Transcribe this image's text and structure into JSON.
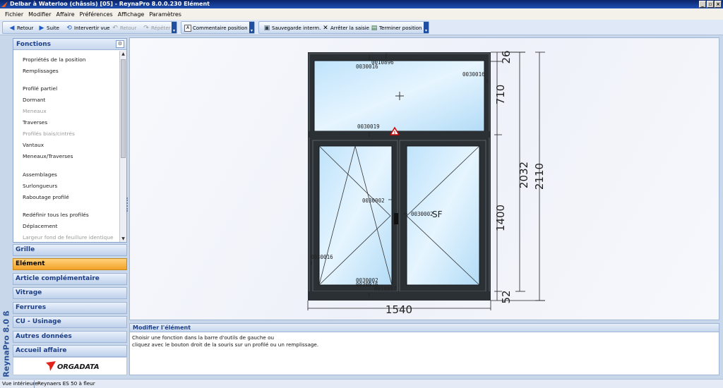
{
  "window": {
    "title": "Delbar à Waterloo (châssis) [05] - ReynaPro 8.0.0.230 Elément",
    "controls": [
      "_",
      "▫",
      "×"
    ]
  },
  "menu": [
    "Fichier",
    "Modifier",
    "Affaire",
    "Préférences",
    "Affichage",
    "Paramètres"
  ],
  "toolbar": {
    "retour": "Retour",
    "suite": "Suite",
    "intervertir": "Intervertir vue",
    "retour_disabled": "Retour",
    "repeter": "Répéter",
    "commentaire": "Commentaire position",
    "sauvegarde": "Sauvegarde interm.",
    "arreter": "Arrêter la saisie",
    "terminer": "Terminer position"
  },
  "brand_vertical": "ReynaPro 8.0 ß",
  "functions": {
    "title": "Fonctions",
    "items": [
      {
        "label": "Propriétés de la position",
        "disabled": false
      },
      {
        "label": "Remplissages",
        "disabled": false
      },
      {
        "label": "",
        "disabled": false
      },
      {
        "label": "Profilé partiel",
        "disabled": false
      },
      {
        "label": "Dormant",
        "disabled": false
      },
      {
        "label": "Meneaux",
        "disabled": true
      },
      {
        "label": "Traverses",
        "disabled": false
      },
      {
        "label": "Profilés biais/cintrés",
        "disabled": true
      },
      {
        "label": "Vantaux",
        "disabled": false
      },
      {
        "label": "Meneaux/Traverses",
        "disabled": false
      },
      {
        "label": "",
        "disabled": false
      },
      {
        "label": "Assemblages",
        "disabled": false
      },
      {
        "label": "Surlongueurs",
        "disabled": false
      },
      {
        "label": "Raboutage profilé",
        "disabled": false
      },
      {
        "label": "",
        "disabled": false
      },
      {
        "label": "Redéfinir tous les profilés",
        "disabled": false
      },
      {
        "label": "Déplacement",
        "disabled": false
      },
      {
        "label": "Largeur fond de feuillure identique",
        "disabled": true
      }
    ]
  },
  "nav": [
    {
      "label": "Grille",
      "active": false
    },
    {
      "label": "Elément",
      "active": true
    },
    {
      "label": "Article complémentaire",
      "active": false
    },
    {
      "label": "Vitrage",
      "active": false
    },
    {
      "label": "Ferrures",
      "active": false
    },
    {
      "label": "CU - Usinage",
      "active": false
    },
    {
      "label": "Autres données",
      "active": false
    },
    {
      "label": "Accueil affaire",
      "active": false
    }
  ],
  "logo_text": "ORGADATA",
  "drawing": {
    "labels": {
      "top_rail": "0010896",
      "top_left": "0030016",
      "top_right": "0030016",
      "transom": "0030019",
      "mullion": "0030002",
      "sash_right": "0030002",
      "sf": "SF",
      "frame_left": "0030016",
      "bottom_center": "0030002",
      "bottom_b": "0030016",
      "bottom_rail": "0010897"
    },
    "dims": {
      "top": "26",
      "upper": "710",
      "lower": "1400",
      "bottom": "52",
      "glass_height": "2032",
      "total_height": "2110",
      "width": "1540"
    }
  },
  "info": {
    "title": "Modifier l'élément",
    "line1": "Choisir une fonction dans la barre d'outils de gauche ou",
    "line2": "cliquez avec le bouton droit de la souris sur un profilé ou un remplissage."
  },
  "status": {
    "view": "Vue intérieure",
    "series": "Reynaers ES 50 à fleur"
  }
}
